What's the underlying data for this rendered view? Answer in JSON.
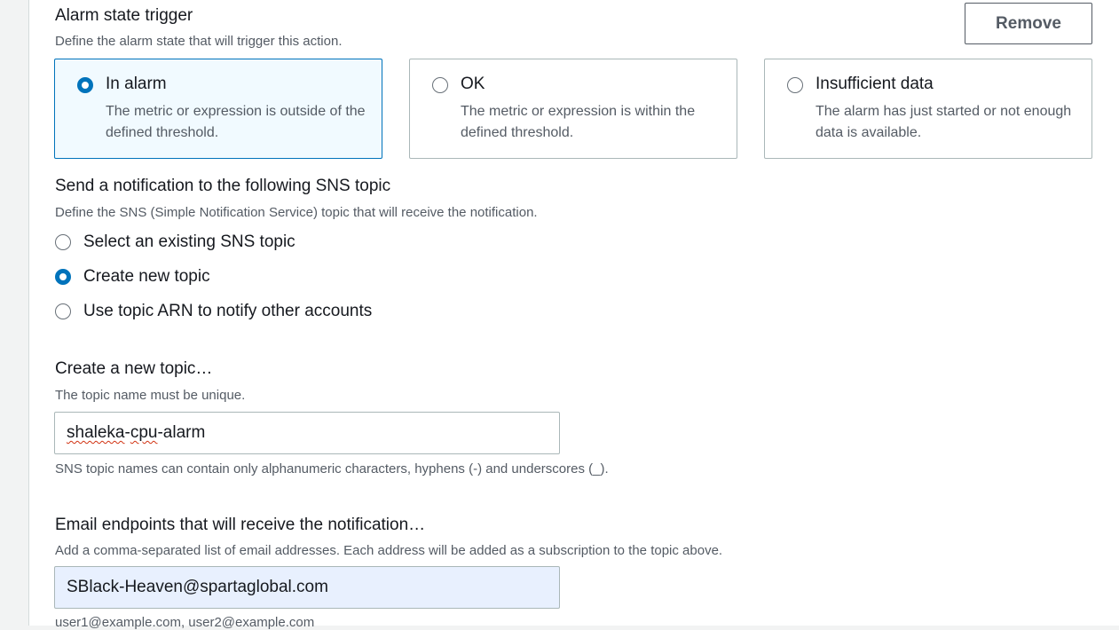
{
  "trigger": {
    "title": "Alarm state trigger",
    "description": "Define the alarm state that will trigger this action.",
    "remove_label": "Remove",
    "options": [
      {
        "label": "In alarm",
        "description": "The metric or expression is outside of the defined threshold.",
        "selected": true
      },
      {
        "label": "OK",
        "description": "The metric or expression is within the defined threshold.",
        "selected": false
      },
      {
        "label": "Insufficient data",
        "description": "The alarm has just started or not enough data is available.",
        "selected": false
      }
    ]
  },
  "sns": {
    "title": "Send a notification to the following SNS topic",
    "description": "Define the SNS (Simple Notification Service) topic that will receive the notification.",
    "options": [
      {
        "label": "Select an existing SNS topic",
        "selected": false
      },
      {
        "label": "Create new topic",
        "selected": true
      },
      {
        "label": "Use topic ARN to notify other accounts",
        "selected": false
      }
    ]
  },
  "new_topic": {
    "title": "Create a new topic…",
    "description": "The topic name must be unique.",
    "value_part1": "shaleka",
    "value_part2": "-",
    "value_part3": "cpu",
    "value_part4": "-alarm",
    "hint": "SNS topic names can contain only alphanumeric characters, hyphens (-) and underscores (_)."
  },
  "email": {
    "title": "Email endpoints that will receive the notification…",
    "description": "Add a comma-separated list of email addresses. Each address will be added as a subscription to the topic above.",
    "value": "SBlack-Heaven@spartaglobal.com",
    "hint": "user1@example.com, user2@example.com"
  },
  "colors": {
    "accent": "#0073bb",
    "selected_tile_bg": "#f1faff",
    "autofill_bg": "#e8f0fe",
    "page_bg": "#f2f3f3"
  }
}
